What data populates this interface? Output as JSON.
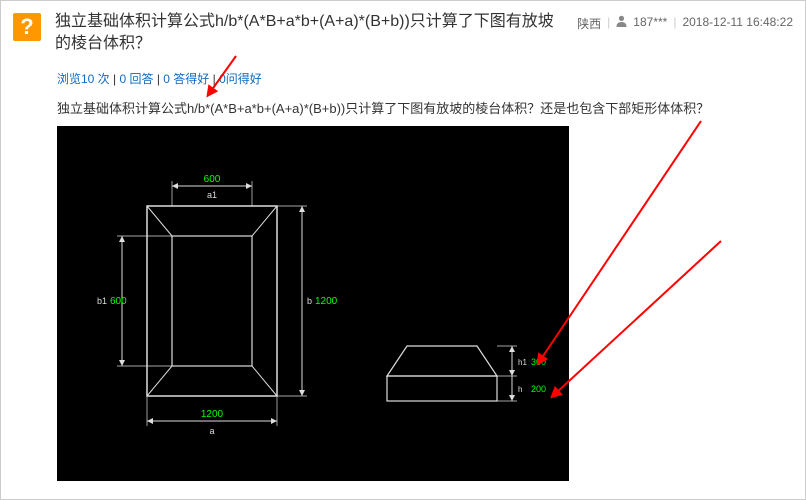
{
  "header": {
    "q_mark": "?",
    "title": "独立基础体积计算公式h/b*(A*B+a*b+(A+a)*(B+b))只计算了下图有放坡的棱台体积？",
    "province": "陕西",
    "user": "187***",
    "date": "2018-12-11 16:48:22"
  },
  "stats": {
    "views": "浏览10 次",
    "answers": "0 回答",
    "good": "0 答得好",
    "ask_good": "0问得好"
  },
  "body": "独立基础体积计算公式h/b*(A*B+a*b+(A+a)*(B+b))只计算了下图有放坡的棱台体积？还是也包含下部矩形体体积？",
  "diagram": {
    "plan": {
      "outer_w_label": "1200",
      "outer_w_dim_letter": "a",
      "top_w_label": "600",
      "top_w_dim_letter": "a1",
      "outer_h_label": "1200",
      "outer_h_dim_letter": "b",
      "inner_h_label": "600",
      "inner_h_dim_letter": "b1"
    },
    "section": {
      "upper_h_label": "300",
      "upper_h_dim_letter": "h1",
      "lower_h_label": "200",
      "lower_h_dim_letter": "h"
    }
  }
}
